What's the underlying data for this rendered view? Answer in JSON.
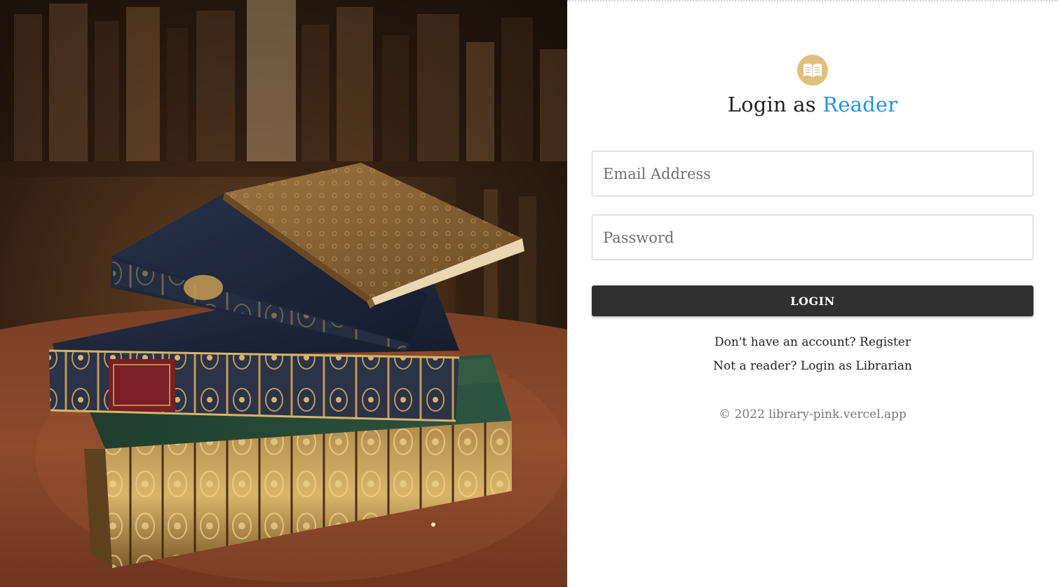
{
  "hero": {
    "image": "stack-of-antique-books"
  },
  "login": {
    "icon": "open-book-icon",
    "title_prefix": "Login as",
    "title_accent": "Reader",
    "accent_color": "#2b8fe0",
    "icon_bg_color": "#e2bf7c",
    "email_placeholder": "Email Address",
    "email_value": "",
    "password_placeholder": "Password",
    "password_value": "",
    "button_label": "LOGIN",
    "button_color": "#2f2f2f",
    "register_link": "Don't have an account? Register",
    "librarian_link": "Not a reader? Login as Librarian",
    "footer": "© 2022 library-pink.vercel.app"
  }
}
